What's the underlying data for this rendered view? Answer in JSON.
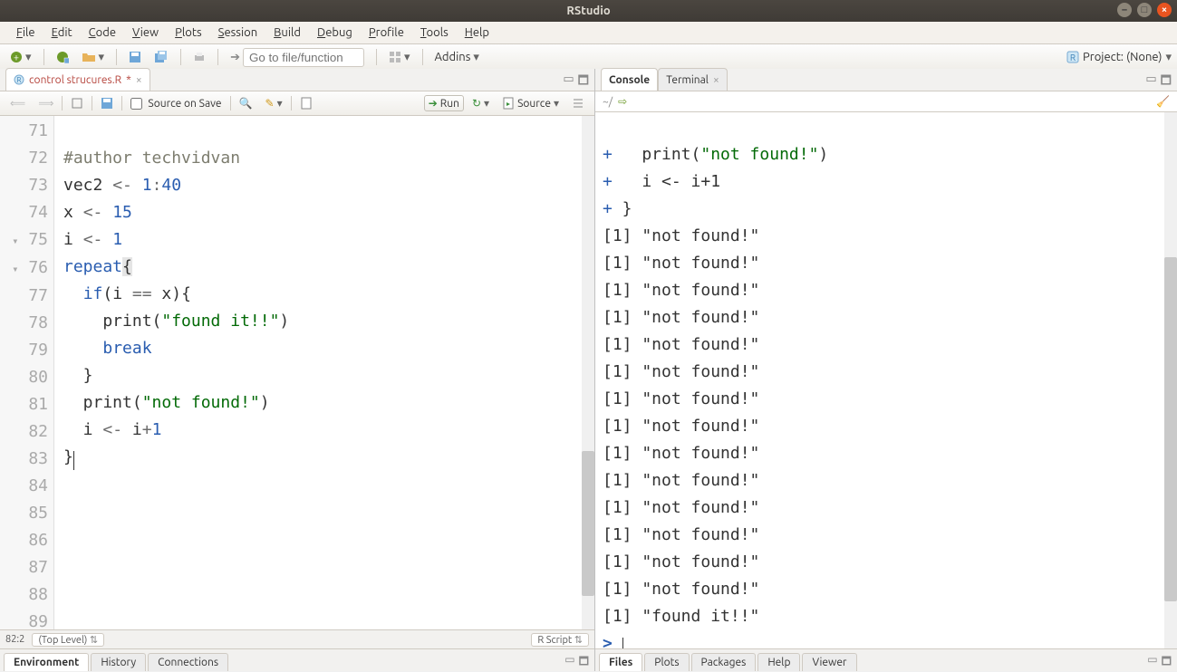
{
  "window": {
    "title": "RStudio"
  },
  "menu": {
    "file": "File",
    "edit": "Edit",
    "code": "Code",
    "view": "View",
    "plots": "Plots",
    "session": "Session",
    "build": "Build",
    "debug": "Debug",
    "profile": "Profile",
    "tools": "Tools",
    "help": "Help"
  },
  "toolbar": {
    "goto_placeholder": "Go to file/function",
    "addins": "Addins",
    "project_label": "Project: (None)"
  },
  "source": {
    "tab_name": "control strucures.R",
    "dirty_mark": "*",
    "source_on_save": "Source on Save",
    "run": "Run",
    "source_btn": "Source",
    "status_line": "82:2",
    "scope": "(Top Level)",
    "script_type": "R Script",
    "gutter": [
      "71",
      "72",
      "73",
      "74",
      "75",
      "76",
      "77",
      "78",
      "79",
      "80",
      "81",
      "82",
      "83",
      "84",
      "85",
      "86",
      "87",
      "88",
      "89"
    ],
    "lines": {
      "l71_comment": "#author techvidvan",
      "l72_a": "vec2 ",
      "l72_b": "<-",
      "l72_c": " ",
      "l72_d": "1",
      "l72_e": ":",
      "l72_f": "40",
      "l73_a": "x ",
      "l73_b": "<-",
      "l73_c": " ",
      "l73_d": "15",
      "l74_a": "i ",
      "l74_b": "<-",
      "l74_c": " ",
      "l74_d": "1",
      "l75_a": "repeat",
      "l75_b": "{",
      "l76_a": "  ",
      "l76_b": "if",
      "l76_c": "(i ",
      "l76_d": "==",
      "l76_e": " x){",
      "l77_a": "    print(",
      "l77_b": "\"found it!!\"",
      "l77_c": ")",
      "l78_a": "    ",
      "l78_b": "break",
      "l79": "  }",
      "l80_a": "  print(",
      "l80_b": "\"not found!\"",
      "l80_c": ")",
      "l81_a": "  i ",
      "l81_b": "<-",
      "l81_c": " i",
      "l81_d": "+",
      "l81_e": "1",
      "l82": "}"
    }
  },
  "console": {
    "tab_console": "Console",
    "tab_terminal": "Terminal",
    "cwd": "~/",
    "lines": {
      "c1_a": "+",
      "c1_b": "   print(",
      "c1_c": "\"not found!\"",
      "c1_d": ")",
      "c2_a": "+",
      "c2_b": "   i ",
      "c2_c": "<-",
      "c2_d": " i+",
      "c2_e": "1",
      "c3_a": "+",
      "c3_b": " }",
      "nf": "[1] \"not found!\"",
      "fit": "[1] \"found it!!\"",
      "prompt": ">"
    }
  },
  "bottom_left": {
    "environment": "Environment",
    "history": "History",
    "connections": "Connections"
  },
  "bottom_right": {
    "files": "Files",
    "plots": "Plots",
    "packages": "Packages",
    "help": "Help",
    "viewer": "Viewer"
  }
}
